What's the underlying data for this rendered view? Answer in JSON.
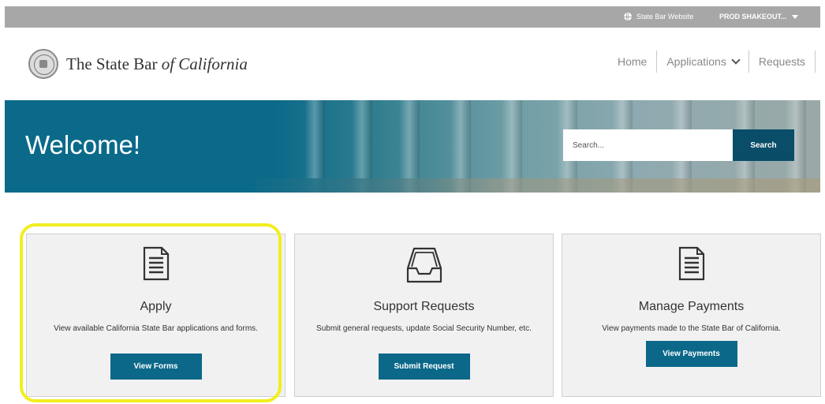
{
  "topbar": {
    "site_link": "State Bar Website",
    "user_menu": "PROD SHAKEOUT..."
  },
  "header": {
    "logo_text_main": "The State Bar ",
    "logo_text_italic": "of California"
  },
  "nav": {
    "home": "Home",
    "applications": "Applications",
    "requests": "Requests"
  },
  "hero": {
    "welcome": "Welcome!",
    "search_placeholder": "Search...",
    "search_button": "Search"
  },
  "cards": [
    {
      "title": "Apply",
      "description": "View available California State Bar applications and forms.",
      "button": "View Forms",
      "icon": "document-icon"
    },
    {
      "title": "Support Requests",
      "description": "Submit general requests, update Social Security Number, etc.",
      "button": "Submit Request",
      "icon": "inbox-tray-icon"
    },
    {
      "title": "Manage Payments",
      "description": "View payments made to the State Bar of California.",
      "button": "View Payments",
      "icon": "document-icon"
    }
  ],
  "colors": {
    "primary": "#0b6889",
    "hero": "#0b6a89",
    "highlight": "#f2ee1f",
    "topbar": "#a7a7a7"
  }
}
